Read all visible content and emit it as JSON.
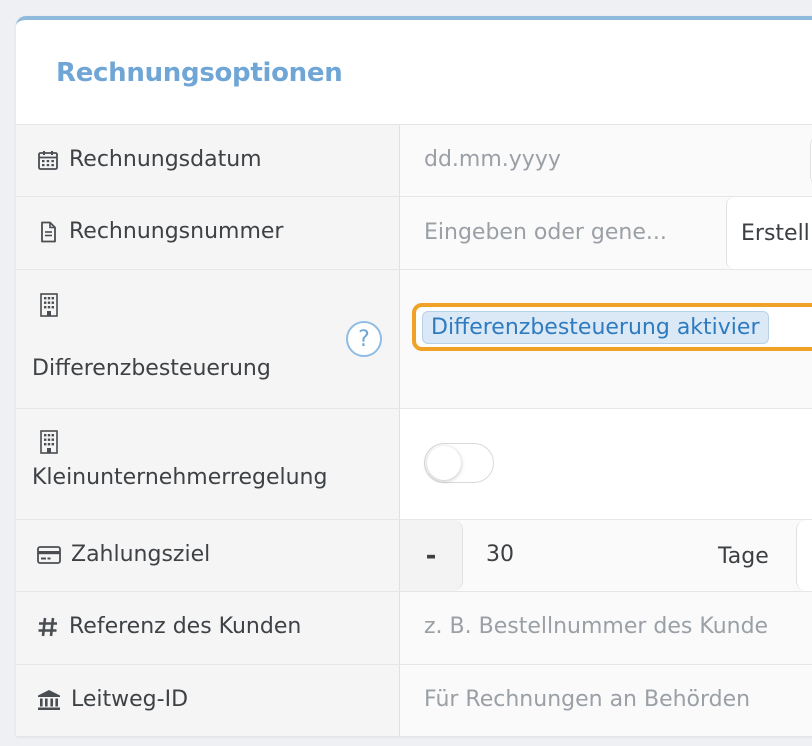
{
  "card": {
    "title": "Rechnungsoptionen"
  },
  "rows": {
    "date": {
      "label": "Rechnungsdatum",
      "placeholder": "dd.mm.yyyy"
    },
    "number": {
      "label": "Rechnungsnummer",
      "placeholder": "Eingeben oder gene...",
      "create_label": "Erstell"
    },
    "diff": {
      "label": "Differenzbesteuerung",
      "help": "?",
      "toggle_label": "Differenzbesteuerung aktivier"
    },
    "small": {
      "label": "Kleinunternehmerregelung",
      "enabled": false
    },
    "payment": {
      "label": "Zahlungsziel",
      "minus": "-",
      "days": "30",
      "unit": "Tage"
    },
    "ref": {
      "label": "Referenz des Kunden",
      "placeholder": "z. B. Bestellnummer des Kunde"
    },
    "leitweg": {
      "label": "Leitweg-ID",
      "placeholder": "Für Rechnungen an Behörden"
    }
  },
  "colors": {
    "accent": "#6fa6d6",
    "focus": "#f0a227",
    "label_bg": "#f5f5f5"
  }
}
